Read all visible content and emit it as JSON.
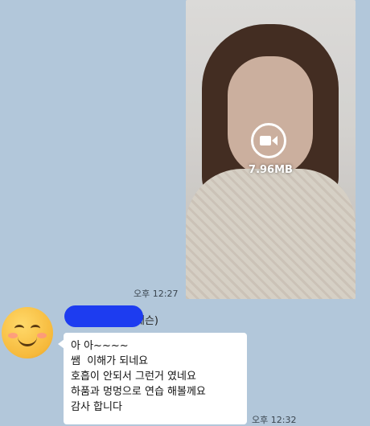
{
  "video_message": {
    "file_size": "7.96MB",
    "icon": "video-camera-icon",
    "time": "오후 12:27"
  },
  "incoming_message": {
    "sender_suffix": "레슨)",
    "lines": [
      "아 아~~~~",
      "쌤  이해가 되네요",
      "호흡이 안되서 그런거 였네요",
      "하품과 멍멍으로 연습 해볼께요",
      "감사 합니다"
    ],
    "time": "오후 12:32"
  },
  "colors": {
    "chat_background": "#b2c7da",
    "name_redaction": "#1d3cf0",
    "bubble": "#ffffff"
  }
}
